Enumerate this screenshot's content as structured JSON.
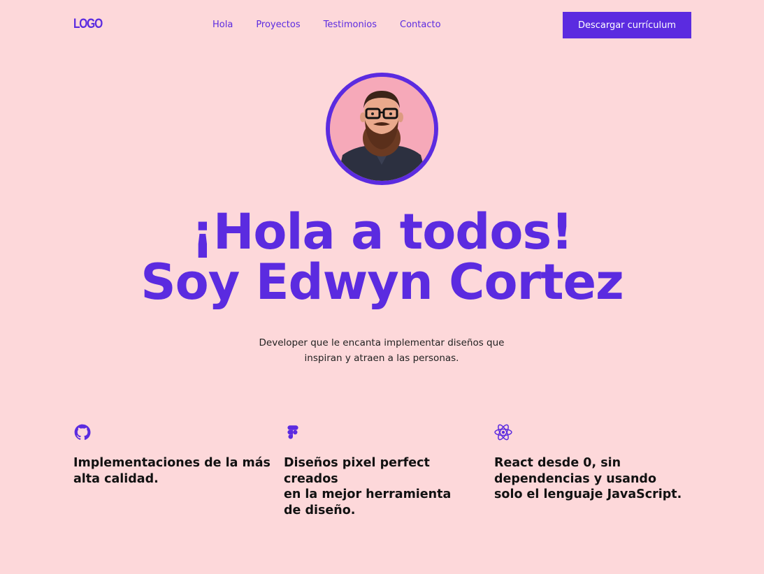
{
  "header": {
    "logo": "LOGO",
    "nav": [
      "Hola",
      "Proyectos",
      "Testimonios",
      "Contacto"
    ],
    "cta_label": "Descargar currículum"
  },
  "hero": {
    "avatar_alt": "",
    "title_line1": "¡Hola a todos!",
    "title_line2": "Soy Edwyn Cortez",
    "subtitle": "Developer que le encanta implementar diseños que inspiran y atraen a las personas."
  },
  "features": [
    {
      "icon": "github-icon",
      "text": "Implementaciones de la más\nalta calidad."
    },
    {
      "icon": "figma-icon",
      "text": "Diseños pixel perfect creados\nen la mejor herramienta\nde diseño."
    },
    {
      "icon": "react-icon",
      "text": "React desde 0, sin\ndependencias y usando\nsolo el lenguaje JavaScript."
    }
  ],
  "colors": {
    "background": "#FDD8DA",
    "accent": "#5B2BE0",
    "text": "#111111"
  }
}
